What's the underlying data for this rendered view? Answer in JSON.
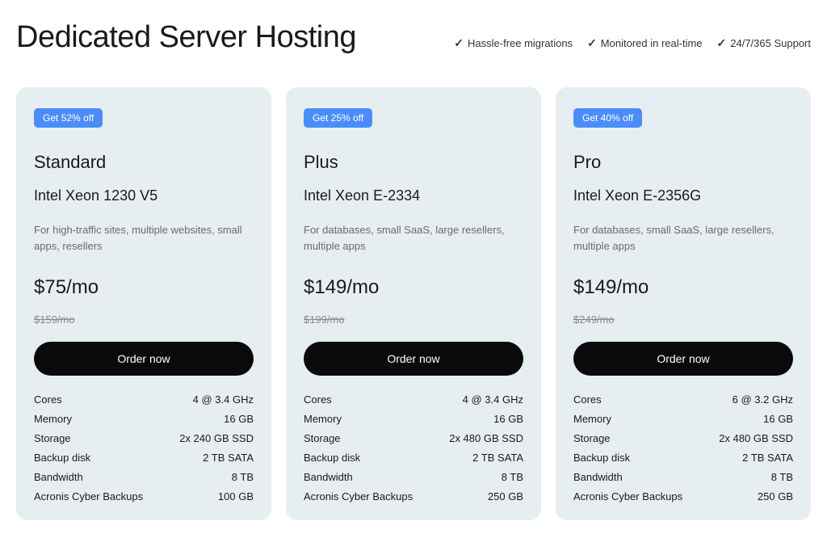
{
  "header": {
    "title": "Dedicated Server Hosting",
    "features": [
      "Hassle-free migrations",
      "Monitored in real-time",
      "24/7/365 Support"
    ]
  },
  "plans": [
    {
      "discount": "Get 52% off",
      "name": "Standard",
      "cpu": "Intel Xeon 1230 V5",
      "desc": "For high-traffic sites, multiple websites, small apps, resellers",
      "price": "$75/mo",
      "orig_price": "$159/mo",
      "order_label": "Order now",
      "specs": [
        {
          "label": "Cores",
          "value": "4 @ 3.4 GHz"
        },
        {
          "label": "Memory",
          "value": "16 GB"
        },
        {
          "label": "Storage",
          "value": "2x 240 GB SSD"
        },
        {
          "label": "Backup disk",
          "value": "2 TB SATA"
        },
        {
          "label": "Bandwidth",
          "value": "8 TB"
        },
        {
          "label": "Acronis Cyber Backups",
          "value": "100 GB"
        }
      ]
    },
    {
      "discount": "Get 25% off",
      "name": "Plus",
      "cpu": "Intel Xeon E-2334",
      "desc": "For databases, small SaaS, large resellers, multiple apps",
      "price": "$149/mo",
      "orig_price": "$199/mo",
      "order_label": "Order now",
      "specs": [
        {
          "label": "Cores",
          "value": "4 @ 3.4 GHz"
        },
        {
          "label": "Memory",
          "value": "16 GB"
        },
        {
          "label": "Storage",
          "value": "2x 480 GB SSD"
        },
        {
          "label": "Backup disk",
          "value": "2 TB SATA"
        },
        {
          "label": "Bandwidth",
          "value": "8 TB"
        },
        {
          "label": "Acronis Cyber Backups",
          "value": "250 GB"
        }
      ]
    },
    {
      "discount": "Get 40% off",
      "name": "Pro",
      "cpu": "Intel Xeon E-2356G",
      "desc": "For databases, small SaaS, large resellers, multiple apps",
      "price": "$149/mo",
      "orig_price": "$249/mo",
      "order_label": "Order now",
      "specs": [
        {
          "label": "Cores",
          "value": "6 @ 3.2 GHz"
        },
        {
          "label": "Memory",
          "value": "16 GB"
        },
        {
          "label": "Storage",
          "value": "2x 480 GB SSD"
        },
        {
          "label": "Backup disk",
          "value": "2 TB SATA"
        },
        {
          "label": "Bandwidth",
          "value": "8 TB"
        },
        {
          "label": "Acronis Cyber Backups",
          "value": "250 GB"
        }
      ]
    }
  ]
}
